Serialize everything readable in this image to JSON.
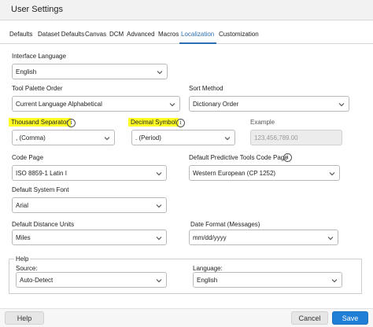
{
  "window": {
    "title": "User Settings"
  },
  "tabs": [
    "Defaults",
    "Dataset Defaults",
    "Canvas",
    "DCM",
    "Advanced",
    "Macros",
    "Localization",
    "Customization"
  ],
  "active_tab": "Localization",
  "fields": {
    "interface_language": {
      "label": "Interface Language",
      "value": "English"
    },
    "tool_palette_order": {
      "label": "Tool Palette Order",
      "value": "Current Language Alphabetical"
    },
    "sort_method": {
      "label": "Sort Method",
      "value": "Dictionary Order"
    },
    "thousand_separator": {
      "label": "Thousand Separator",
      "value": ", (Comma)"
    },
    "decimal_symbol": {
      "label": "Decimal Symbol",
      "value": ". (Period)"
    },
    "example": {
      "label": "Example",
      "value": "123,456,789.00"
    },
    "code_page": {
      "label": "Code Page",
      "value": "ISO 8859-1 Latin I"
    },
    "default_predictive_code_page": {
      "label": "Default Predictive Tools Code Page",
      "value": "Western European (CP 1252)"
    },
    "default_system_font": {
      "label": "Default System Font",
      "value": "Arial"
    },
    "default_distance_units": {
      "label": "Default Distance Units",
      "value": "Miles"
    },
    "date_format": {
      "label": "Date Format (Messages)",
      "value": "mm/dd/yyyy"
    }
  },
  "help_group": {
    "title": "Help",
    "source": {
      "label": "Source:",
      "value": "Auto-Detect"
    },
    "language": {
      "label": "Language:",
      "value": "English"
    }
  },
  "buttons": {
    "help": "Help",
    "cancel": "Cancel",
    "save": "Save"
  },
  "colors": {
    "accent": "#2a6fb0",
    "highlight": "#ffff24",
    "primary_button": "#1f7fd6"
  }
}
